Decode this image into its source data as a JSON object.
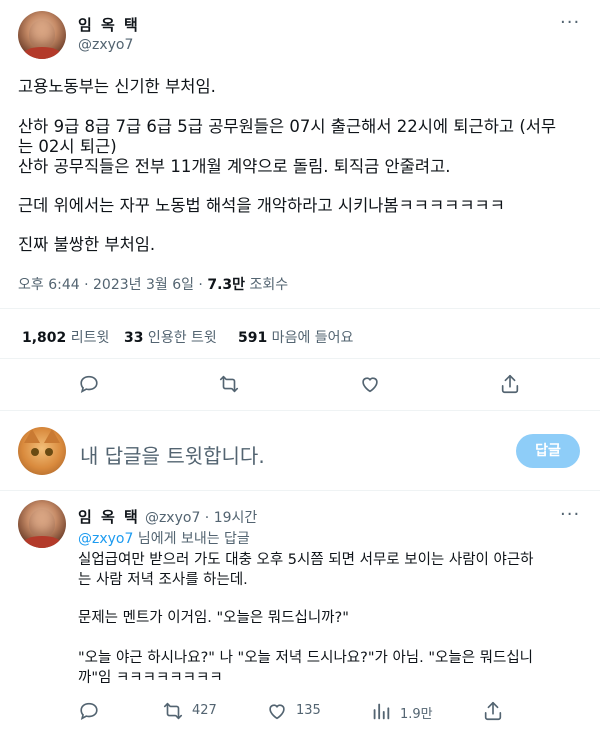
{
  "main_tweet": {
    "author_name": "임 옥 택",
    "author_handle": "@zxyo7",
    "more_icon": "ellipsis-icon",
    "lines": [
      "고용노동부는 신기한 부처임.",
      "산하 9급 8급 7급 6급 5급 공무원들은 07시 출근해서 22시에 퇴근하고 (서무",
      "는 02시 퇴근)",
      "산하 공무직들은 전부 11개월 계약으로 돌림. 퇴직금 안줄려고.",
      "근데 위에서는 자꾸 노동법 해석을 개악하라고 시키나봄ㅋㅋㅋㅋㅋㅋㅋ",
      "진짜 불쌍한 부처임."
    ],
    "timestamp": "오후 6:44 · 2023년 3월 6일 · ",
    "views_count": "7.3만",
    "views_label": " 조회수",
    "stats": {
      "retweets_count": "1,802",
      "retweets_label": " 리트윗",
      "quotes_count": "33",
      "quotes_label": " 인용한 트윗",
      "likes_count": "591",
      "likes_label": " 마음에 들어요"
    }
  },
  "reply_composer": {
    "placeholder": "내 답글을 트윗합니다.",
    "button_label": "답글"
  },
  "reply_tweet": {
    "author_name": "임 옥 택",
    "author_handle": "@zxyo7 · 19시간",
    "replying_to_handle": "@zxyo7",
    "replying_to_suffix": " 님에게 보내는 답글",
    "lines": [
      "실업급여만 받으러 가도 대충 오후 5시쯤 되면 서무로 보이는 사람이 야근하",
      "는 사람 저녁 조사를 하는데.",
      "문제는 멘트가 이거임. \"오늘은 뭐드십니까?\"",
      "\"오늘 야근 하시나요?\" 나 \"오늘 저녁 드시나요?\"가 아님. \"오늘은 뭐드십니",
      "까\"임 ㅋㅋㅋㅋㅋㅋㅋㅋ"
    ],
    "actions": {
      "retweets": "427",
      "likes": "135",
      "views": "1.9만"
    }
  },
  "colors": {
    "accent": "#1d9bf0",
    "button_disabled": "#8ecdf8",
    "muted_text": "#536471",
    "divider": "#eff3f4"
  }
}
